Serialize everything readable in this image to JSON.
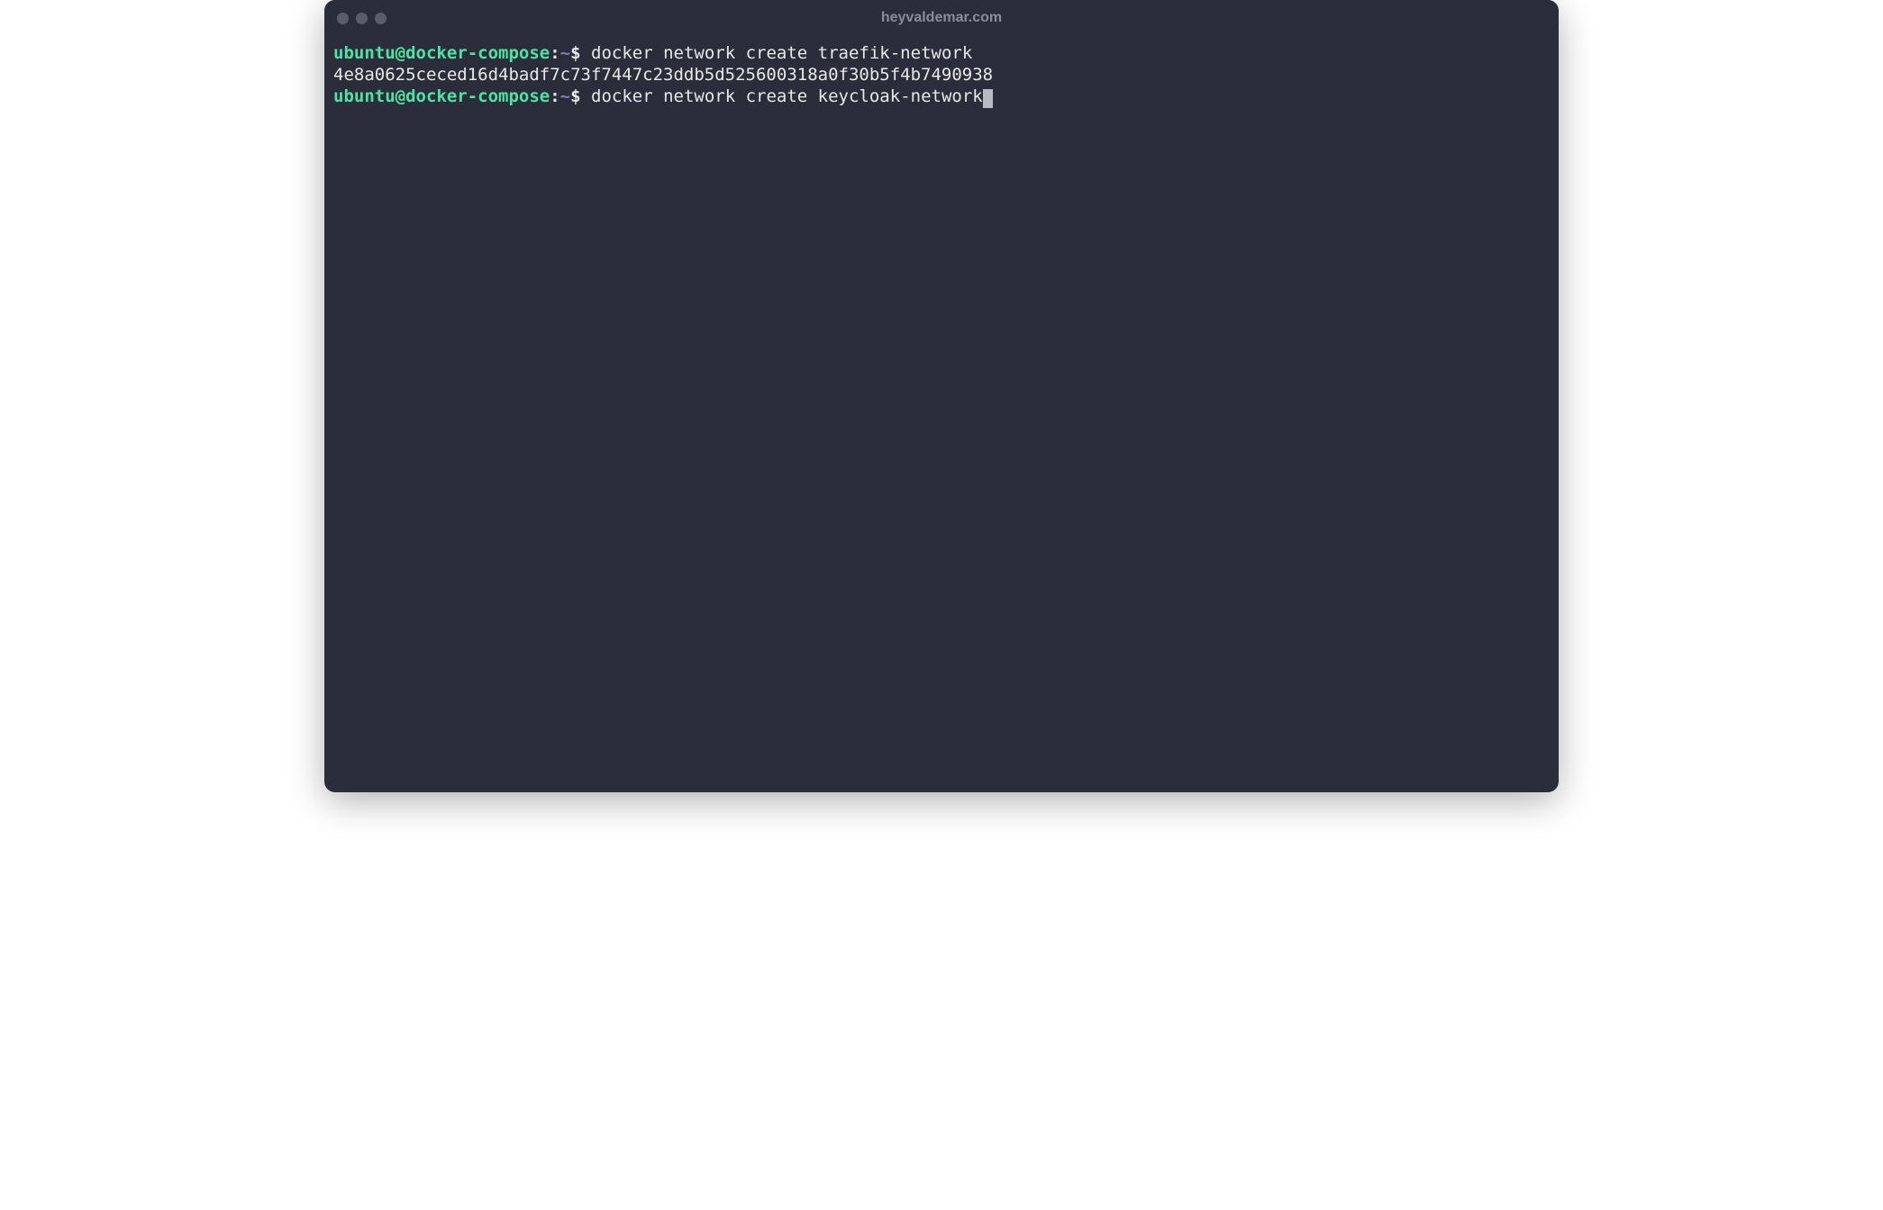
{
  "window": {
    "title": "heyvaldemar.com"
  },
  "prompt": {
    "user_host": "ubuntu@docker-compose",
    "colon": ":",
    "path": "~",
    "symbol": "$"
  },
  "lines": [
    {
      "type": "command",
      "text": " docker network create traefik-network"
    },
    {
      "type": "output",
      "text": "4e8a0625ceced16d4badf7c73f7447c23ddb5d525600318a0f30b5f4b7490938"
    },
    {
      "type": "command_active",
      "text": " docker network create keycloak-network"
    }
  ]
}
